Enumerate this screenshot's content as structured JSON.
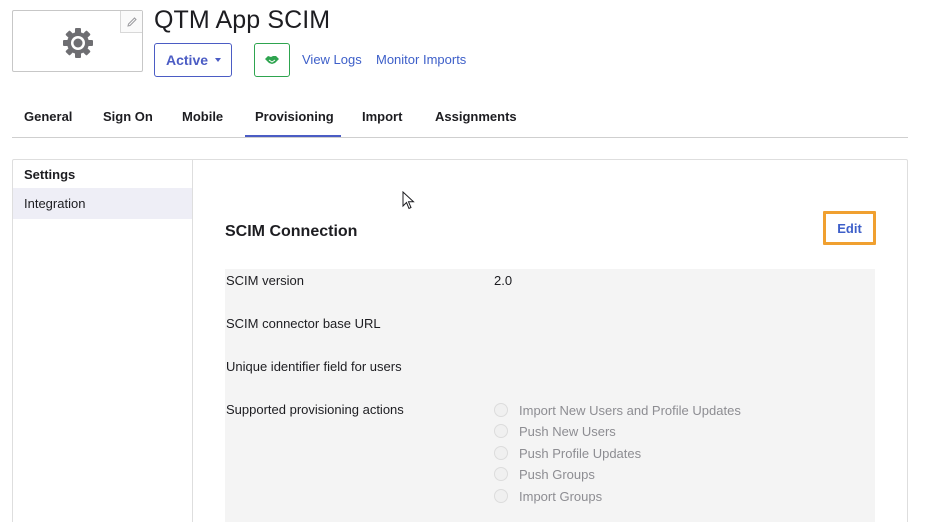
{
  "header": {
    "app_name": "QTM App SCIM",
    "status_label": "Active",
    "view_logs_label": "View Logs",
    "monitor_imports_label": "Monitor Imports",
    "logo_icon": "gear-icon",
    "handshake_icon": "handshake-icon",
    "edit_logo_icon": "pencil-icon"
  },
  "tabs": [
    {
      "label": "General"
    },
    {
      "label": "Sign On"
    },
    {
      "label": "Mobile"
    },
    {
      "label": "Provisioning",
      "active": true
    },
    {
      "label": "Import"
    },
    {
      "label": "Assignments"
    }
  ],
  "side_nav": {
    "heading": "Settings",
    "items": [
      {
        "label": "Integration",
        "selected": true
      }
    ]
  },
  "scim": {
    "title": "SCIM Connection",
    "edit_label": "Edit",
    "fields": [
      {
        "label": "SCIM version",
        "value": "2.0"
      },
      {
        "label": "SCIM connector base URL",
        "value": ""
      },
      {
        "label": "Unique identifier field for users",
        "value": ""
      },
      {
        "label": "Supported provisioning actions",
        "value": ""
      }
    ],
    "actions": [
      {
        "label": "Import New Users and Profile Updates",
        "checked": false
      },
      {
        "label": "Push New Users",
        "checked": false
      },
      {
        "label": "Push Profile Updates",
        "checked": false
      },
      {
        "label": "Push Groups",
        "checked": false
      },
      {
        "label": "Import Groups",
        "checked": false
      }
    ]
  },
  "colors": {
    "accent": "#4b5cc4",
    "link": "#3d5fc9",
    "success": "#2ea44f",
    "highlight": "#f0a030"
  }
}
